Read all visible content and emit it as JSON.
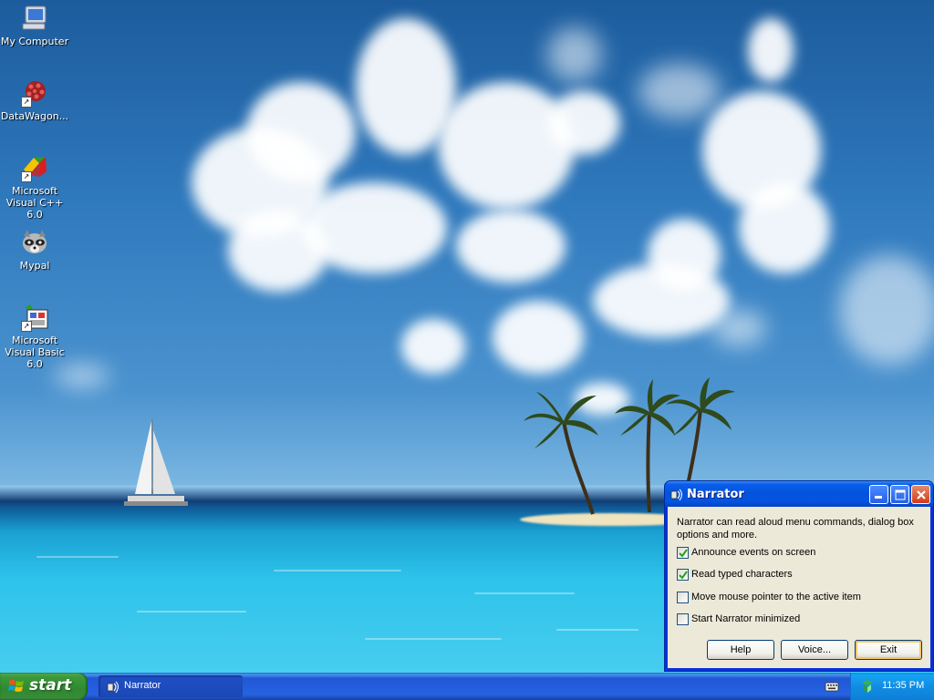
{
  "desktop": {
    "icons": [
      {
        "label": "My Computer",
        "icon": "computer-icon"
      },
      {
        "label": "DataWagon...",
        "icon": "datawagon-icon"
      },
      {
        "label": "Microsoft Visual C++ 6.0",
        "icon": "visual-cpp-icon"
      },
      {
        "label": "Mypal",
        "icon": "raccoon-icon"
      },
      {
        "label": "Microsoft Visual Basic 6.0",
        "icon": "visual-basic-icon"
      }
    ]
  },
  "narrator": {
    "title": "Narrator",
    "description": "Narrator can read aloud menu commands, dialog box options and more.",
    "options": [
      {
        "label": "Announce events on screen",
        "checked": true
      },
      {
        "label": "Read typed characters",
        "checked": true
      },
      {
        "label": "Move mouse pointer to the active item",
        "checked": false
      },
      {
        "label": "Start Narrator minimized",
        "checked": false
      }
    ],
    "buttons": {
      "help": "Help",
      "voice": "Voice...",
      "exit": "Exit"
    }
  },
  "taskbar": {
    "start_label": "start",
    "tasks": [
      {
        "label": "Narrator"
      }
    ],
    "clock": "11:35 PM"
  },
  "colors": {
    "title_bar": "#0453de",
    "dialog_bg": "#ece9d8",
    "taskbar": "#2663e0",
    "start_button": "#3c9a3b"
  }
}
